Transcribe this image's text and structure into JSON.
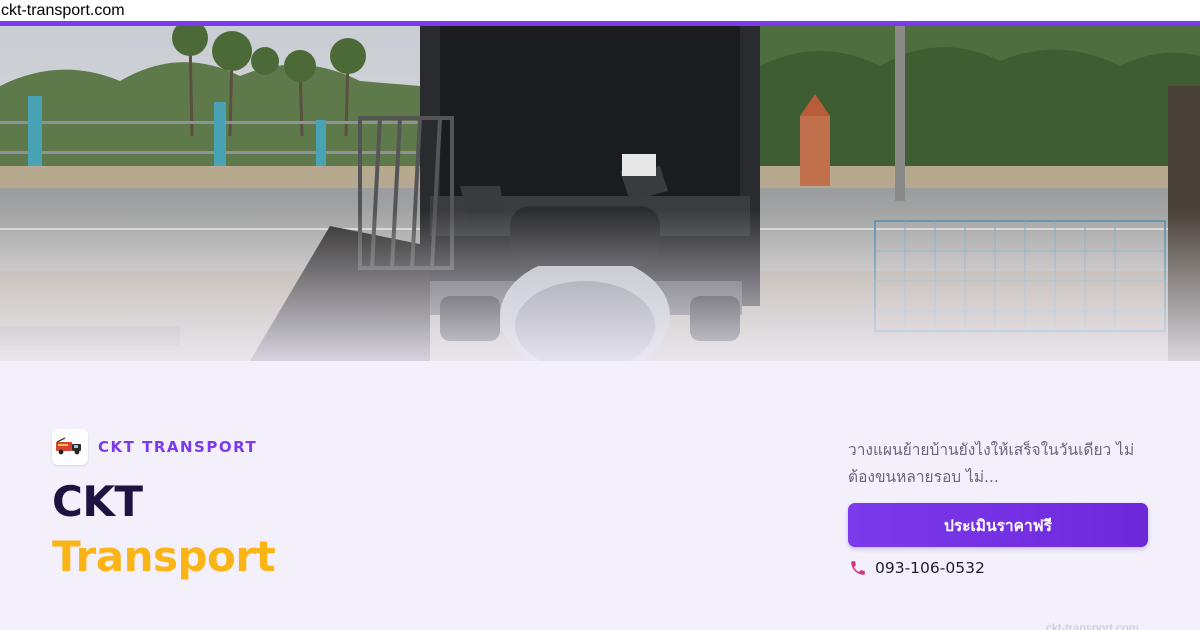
{
  "url_bar": {
    "text": "ckt-transport.com"
  },
  "theme": {
    "accent": "#7c3aed",
    "title_dark": "#1e1240",
    "title_gold": "#fbb416",
    "card_bg": "#f3f0fc"
  },
  "hero": {
    "image_icon": "truck-loading-motorcycle-photo"
  },
  "brand": {
    "logo_icon": "tow-truck-logo-icon",
    "label": "CKT TRANSPORT"
  },
  "title": {
    "line1": "CKT",
    "line2": "Transport"
  },
  "description": "วางแผนย้ายบ้านยังไงให้เสร็จในวันเดียว ไม่ต้องขนหลายรอบ ไม่...",
  "cta": {
    "label": "ประเมินราคาฟรี"
  },
  "contact": {
    "phone_icon": "phone-icon",
    "phone": "093-106-0532"
  },
  "watermark": "ckt-transport.com"
}
